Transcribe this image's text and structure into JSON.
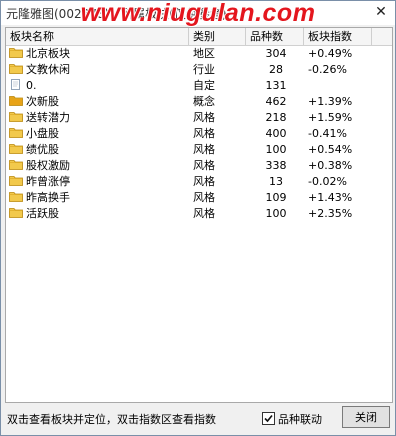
{
  "window": {
    "title": "元隆雅图(002878) - 所属板块(仅供参考)",
    "watermark": "www.niugulan.com"
  },
  "table": {
    "headers": [
      "板块名称",
      "类别",
      "品种数",
      "板块指数"
    ],
    "rows": [
      {
        "name": "北京板块",
        "category": "地区",
        "count": "304",
        "index": "+0.49%",
        "icon": "folder-icon"
      },
      {
        "name": "文教休闲",
        "category": "行业",
        "count": "28",
        "index": "-0.26%",
        "icon": "folder-icon"
      },
      {
        "name": "0.",
        "category": "自定",
        "count": "131",
        "index": "",
        "icon": "document-icon"
      },
      {
        "name": "次新股",
        "category": "概念",
        "count": "462",
        "index": "+1.39%",
        "icon": "folder-icon"
      },
      {
        "name": "送转潜力",
        "category": "风格",
        "count": "218",
        "index": "+1.59%",
        "icon": "folder-icon"
      },
      {
        "name": "小盘股",
        "category": "风格",
        "count": "400",
        "index": "-0.41%",
        "icon": "folder-icon"
      },
      {
        "name": "绩优股",
        "category": "风格",
        "count": "100",
        "index": "+0.54%",
        "icon": "folder-icon"
      },
      {
        "name": "股权激励",
        "category": "风格",
        "count": "338",
        "index": "+0.38%",
        "icon": "folder-icon"
      },
      {
        "name": "昨曾涨停",
        "category": "风格",
        "count": "13",
        "index": "-0.02%",
        "icon": "folder-icon"
      },
      {
        "name": "昨高换手",
        "category": "风格",
        "count": "109",
        "index": "+1.43%",
        "icon": "folder-icon"
      },
      {
        "name": "活跃股",
        "category": "风格",
        "count": "100",
        "index": "+2.35%",
        "icon": "folder-icon"
      }
    ]
  },
  "status": {
    "hint": "双击查看板块并定位，双击指数区查看指数",
    "checkbox_label": "品种联动",
    "checkbox_checked": true,
    "close_button": "关闭"
  },
  "colors": {
    "folder": "#f2c94c",
    "folder_selected": "#e8a317",
    "watermark": "#e4161e"
  }
}
